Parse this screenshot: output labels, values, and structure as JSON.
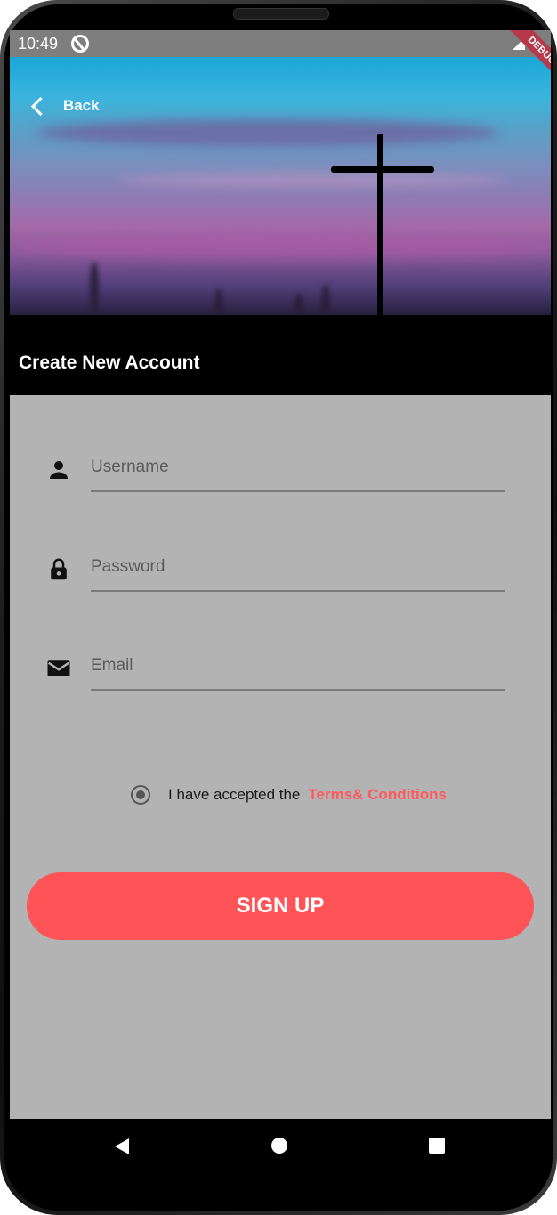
{
  "status_bar": {
    "time": "10:49",
    "icons": [
      "sync-icon",
      "signal-icon",
      "battery-icon"
    ]
  },
  "debug_banner": "DEBUG",
  "header": {
    "back_label": "Back",
    "title": "Create New Account",
    "image_subject": "cross-silhouette-sunset"
  },
  "form": {
    "username": {
      "placeholder": "Username",
      "value": "",
      "icon": "person-icon"
    },
    "password": {
      "placeholder": "Password",
      "value": "",
      "icon": "lock-icon"
    },
    "email": {
      "placeholder": "Email",
      "value": "",
      "icon": "mail-icon"
    }
  },
  "terms": {
    "text": "I have accepted the",
    "link": "Terms& Conditions",
    "checked": true
  },
  "signup_label": "SIGN UP",
  "colors": {
    "accent": "#fe5457",
    "screen_background": "#b3b3b3",
    "link": "#ff5a5f"
  },
  "nav_bar": {
    "icons": [
      "nav-back-icon",
      "nav-home-icon",
      "nav-recents-icon"
    ]
  }
}
